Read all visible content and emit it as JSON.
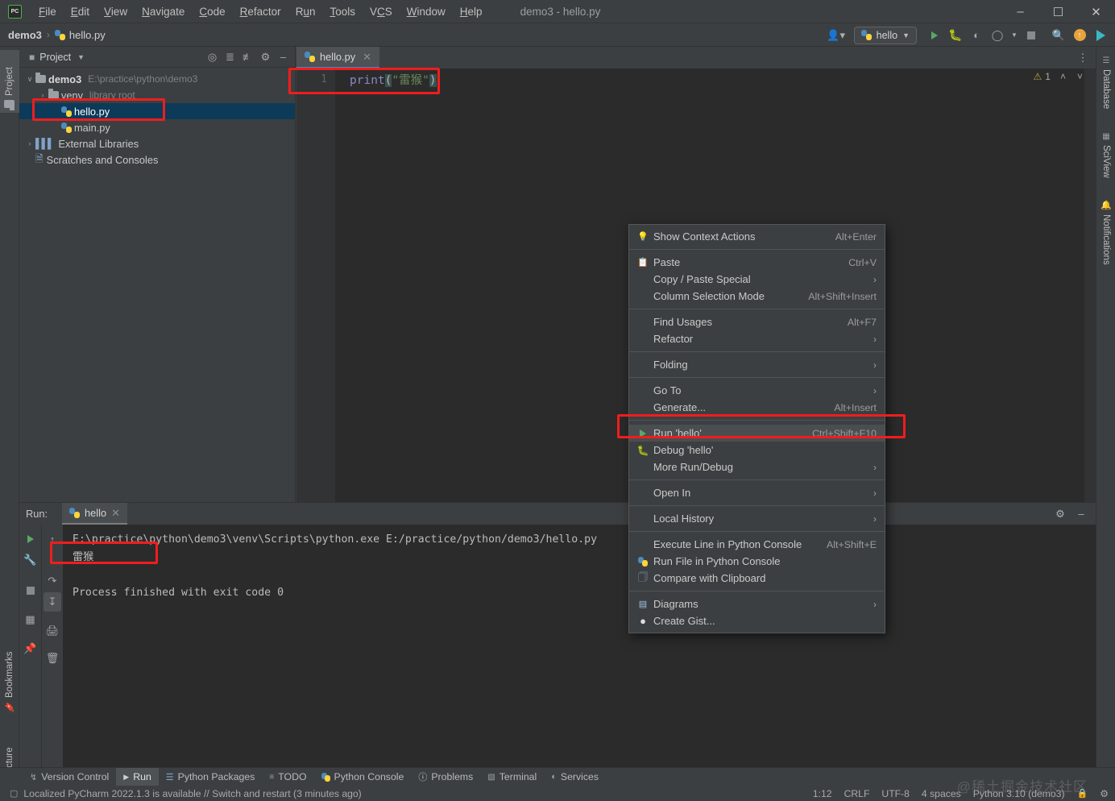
{
  "window": {
    "title": "demo3 - hello.py",
    "logo_text": "PC",
    "minimize": "–",
    "maximize": "☐",
    "close": "✕"
  },
  "menubar": [
    {
      "label": "File"
    },
    {
      "label": "Edit"
    },
    {
      "label": "View"
    },
    {
      "label": "Navigate"
    },
    {
      "label": "Code"
    },
    {
      "label": "Refactor"
    },
    {
      "label": "Run"
    },
    {
      "label": "Tools"
    },
    {
      "label": "VCS"
    },
    {
      "label": "Window"
    },
    {
      "label": "Help"
    }
  ],
  "breadcrumb": {
    "project": "demo3",
    "separator": "›",
    "file": "hello.py"
  },
  "toolbar": {
    "account_icon": "account-icon",
    "run_config": "hello",
    "run_icon": "run-icon",
    "debug_icon": "debug-icon",
    "coverage_icon": "coverage-icon",
    "profile_icon": "profile-icon",
    "stop_icon": "stop-icon",
    "search_icon": "search-icon",
    "update_icon": "update-icon",
    "ai_icon": "ai-icon"
  },
  "left_strip": {
    "project": "Project",
    "bookmarks": "Bookmarks",
    "structure": "Structure"
  },
  "right_strip": {
    "database": "Database",
    "sciview": "SciView",
    "notifications": "Notifications"
  },
  "project_panel": {
    "title": "Project",
    "icons": [
      "locate-icon",
      "expand-all-icon",
      "collapse-all-icon",
      "settings-icon",
      "hide-icon"
    ],
    "tree": [
      {
        "name": "demo3",
        "path": "E:\\practice\\python\\demo3",
        "depth": 0,
        "twist": "∨",
        "icon": "folder-icon",
        "bold": true,
        "selected": false
      },
      {
        "name": "venv",
        "path": "library root",
        "depth": 1,
        "twist": "›",
        "icon": "folder-icon",
        "bold": false,
        "selected": false
      },
      {
        "name": "hello.py",
        "path": "",
        "depth": 2,
        "twist": "",
        "icon": "python-file-icon",
        "bold": false,
        "selected": true
      },
      {
        "name": "main.py",
        "path": "",
        "depth": 2,
        "twist": "",
        "icon": "python-file-icon",
        "bold": false,
        "selected": false
      },
      {
        "name": "External Libraries",
        "path": "",
        "depth": 0,
        "twist": "›",
        "icon": "libraries-icon",
        "bold": false,
        "selected": false
      },
      {
        "name": "Scratches and Consoles",
        "path": "",
        "depth": 0,
        "twist": "",
        "icon": "scratches-icon",
        "bold": false,
        "selected": false
      }
    ]
  },
  "editor": {
    "tab_label": "hello.py",
    "tab_close": "✕",
    "line_number": "1",
    "code": {
      "fn": "print",
      "open_paren": "(",
      "quote": "\"",
      "text": "雷猴",
      "close_paren": ")"
    },
    "warning_count": "1",
    "warning_icon": "warning-icon",
    "nav_up": "˄",
    "nav_down": "˅",
    "more_icon": "⋮"
  },
  "context_menu": {
    "items": [
      {
        "label": "Show Context Actions",
        "accel": "Alt+Enter",
        "icon": "lightbulb-icon",
        "submenu": false,
        "highlight": false,
        "mnemonic": ""
      },
      {
        "sep": true
      },
      {
        "label": "Paste",
        "accel": "Ctrl+V",
        "icon": "clipboard-icon",
        "submenu": false,
        "highlight": false,
        "mnemonic": "P"
      },
      {
        "label": "Copy / Paste Special",
        "accel": "",
        "icon": "",
        "submenu": true,
        "highlight": false,
        "mnemonic": ""
      },
      {
        "label": "Column Selection Mode",
        "accel": "Alt+Shift+Insert",
        "icon": "",
        "submenu": false,
        "highlight": false,
        "mnemonic": "M"
      },
      {
        "sep": true
      },
      {
        "label": "Find Usages",
        "accel": "Alt+F7",
        "icon": "",
        "submenu": false,
        "highlight": false,
        "mnemonic": "U"
      },
      {
        "label": "Refactor",
        "accel": "",
        "icon": "",
        "submenu": true,
        "highlight": false,
        "mnemonic": "R"
      },
      {
        "sep": true
      },
      {
        "label": "Folding",
        "accel": "",
        "icon": "",
        "submenu": true,
        "highlight": false,
        "mnemonic": ""
      },
      {
        "sep": true
      },
      {
        "label": "Go To",
        "accel": "",
        "icon": "",
        "submenu": true,
        "highlight": false,
        "mnemonic": ""
      },
      {
        "label": "Generate...",
        "accel": "Alt+Insert",
        "icon": "",
        "submenu": false,
        "highlight": false,
        "mnemonic": ""
      },
      {
        "sep": true
      },
      {
        "label": "Run 'hello'",
        "accel": "Ctrl+Shift+F10",
        "icon": "run-icon",
        "submenu": false,
        "highlight": true,
        "mnemonic": "u"
      },
      {
        "label": "Debug 'hello'",
        "accel": "",
        "icon": "debug-icon",
        "submenu": false,
        "highlight": false,
        "mnemonic": ""
      },
      {
        "label": "More Run/Debug",
        "accel": "",
        "icon": "",
        "submenu": true,
        "highlight": false,
        "mnemonic": ""
      },
      {
        "sep": true
      },
      {
        "label": "Open In",
        "accel": "",
        "icon": "",
        "submenu": true,
        "highlight": false,
        "mnemonic": ""
      },
      {
        "sep": true
      },
      {
        "label": "Local History",
        "accel": "",
        "icon": "",
        "submenu": true,
        "highlight": false,
        "mnemonic": "H"
      },
      {
        "sep": true
      },
      {
        "label": "Execute Line in Python Console",
        "accel": "Alt+Shift+E",
        "icon": "",
        "submenu": false,
        "highlight": false,
        "mnemonic": ""
      },
      {
        "label": "Run File in Python Console",
        "accel": "",
        "icon": "python-icon",
        "submenu": false,
        "highlight": false,
        "mnemonic": ""
      },
      {
        "label": "Compare with Clipboard",
        "accel": "",
        "icon": "compare-icon",
        "submenu": false,
        "highlight": false,
        "mnemonic": "b"
      },
      {
        "sep": true
      },
      {
        "label": "Diagrams",
        "accel": "",
        "icon": "diagram-icon",
        "submenu": true,
        "highlight": false,
        "mnemonic": ""
      },
      {
        "label": "Create Gist...",
        "accel": "",
        "icon": "github-icon",
        "submenu": false,
        "highlight": false,
        "mnemonic": ""
      }
    ]
  },
  "run_panel": {
    "label": "Run:",
    "tab": "hello",
    "tab_close": "✕",
    "settings_icon": "settings-icon",
    "hide_icon": "hide-icon",
    "left_icons": [
      "rerun-icon",
      "wrench-icon",
      "stop-icon",
      "layout-icon",
      "pin-icon"
    ],
    "right_icons": [
      "scroll-up-icon",
      "soft-wrap-icon",
      "scroll-end-icon",
      "print-icon",
      "trash-icon"
    ],
    "console_lines": [
      "E:\\practice\\python\\demo3\\venv\\Scripts\\python.exe E:/practice/python/demo3/hello.py",
      "雷猴",
      "",
      "Process finished with exit code 0"
    ]
  },
  "bottom_bar": [
    {
      "label": "Version Control",
      "icon": "branch-icon",
      "selected": false
    },
    {
      "label": "Run",
      "icon": "run-icon",
      "selected": true
    },
    {
      "label": "Python Packages",
      "icon": "packages-icon",
      "selected": false
    },
    {
      "label": "TODO",
      "icon": "todo-icon",
      "selected": false
    },
    {
      "label": "Python Console",
      "icon": "python-console-icon",
      "selected": false
    },
    {
      "label": "Problems",
      "icon": "problems-icon",
      "selected": false
    },
    {
      "label": "Terminal",
      "icon": "terminal-icon",
      "selected": false
    },
    {
      "label": "Services",
      "icon": "services-icon",
      "selected": false
    }
  ],
  "statusbar": {
    "notice_icon": "notice-icon",
    "notice": "Localized PyCharm 2022.1.3 is available // Switch and restart (3 minutes ago)",
    "caret": "1:12",
    "line_sep": "CRLF",
    "encoding": "UTF-8",
    "indent": "4 spaces",
    "interpreter": "Python 3.10 (demo3)",
    "lock_icon": "lock-icon",
    "inspection_icon": "inspection-icon"
  },
  "watermark": "@稀土掘金技术社区",
  "colors": {
    "chrome": "#3c3f41",
    "editor_bg": "#2b2b2b",
    "selection": "#0d3a58",
    "accent_blue": "#4a88c7",
    "annotation_red": "#f01d1d",
    "green": "#59a869",
    "string_green": "#6a8759",
    "fn_purple": "#8888c6"
  }
}
